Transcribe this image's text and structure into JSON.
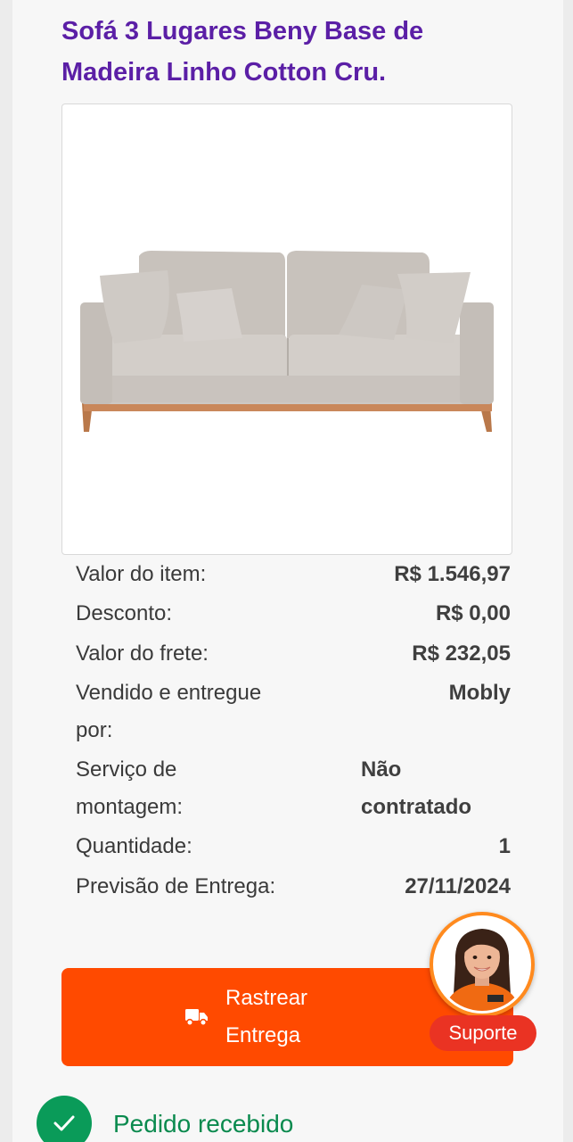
{
  "product": {
    "title": "Sofá 3 Lugares Beny Base de Madeira Linho Cotton Cru."
  },
  "details": {
    "item_value_label": "Valor do item:",
    "item_value": "R$ 1.546,97",
    "discount_label": "Desconto:",
    "discount": "R$ 0,00",
    "shipping_label": "Valor do frete:",
    "shipping": "R$ 232,05",
    "seller_label": "Vendido e entregue por:",
    "seller": "Mobly",
    "assembly_label": "Serviço de montagem:",
    "assembly": "Não contratado",
    "quantity_label": "Quantidade:",
    "quantity": "1",
    "delivery_label": "Previsão de Entrega:",
    "delivery": "27/11/2024"
  },
  "actions": {
    "track_label": "Rastrear Entrega",
    "track_icon": "truck-icon"
  },
  "support": {
    "label": "Suporte",
    "icon": "avatar"
  },
  "status": {
    "label": "Pedido recebido",
    "icon": "check-icon"
  },
  "colors": {
    "title": "#5b1fa6",
    "primary_button": "#ff4a00",
    "support_badge": "#ea3323",
    "status_green": "#0a9b59"
  }
}
